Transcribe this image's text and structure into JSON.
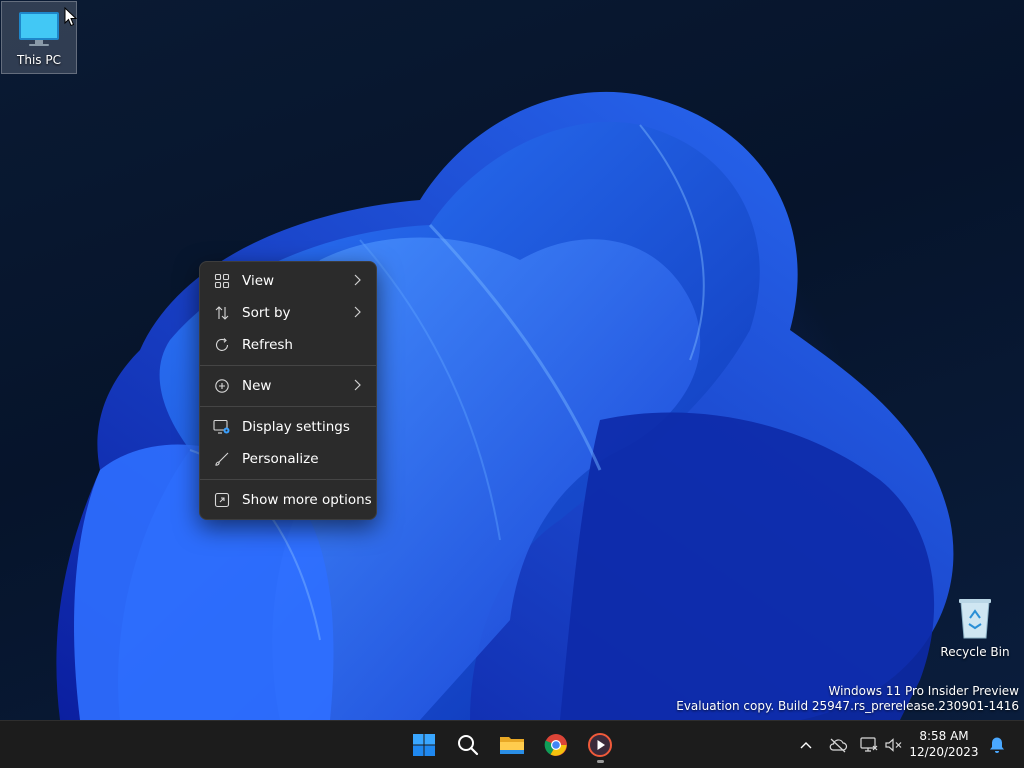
{
  "desktop": {
    "icons": [
      {
        "label": "This PC",
        "icon": "monitor-icon"
      },
      {
        "label": "Recycle Bin",
        "icon": "recycle-bin-icon"
      }
    ],
    "watermark": {
      "line1": "Windows 11 Pro Insider Preview",
      "line2": "Evaluation copy. Build 25947.rs_prerelease.230901-1416"
    }
  },
  "context_menu": {
    "items": [
      {
        "label": "View",
        "icon": "grid-view-icon",
        "submenu": true
      },
      {
        "label": "Sort by",
        "icon": "sort-arrows-icon",
        "submenu": true
      },
      {
        "label": "Refresh",
        "icon": "refresh-icon",
        "submenu": false
      },
      {
        "label": "New",
        "icon": "plus-circle-icon",
        "submenu": true
      },
      {
        "label": "Display settings",
        "icon": "display-settings-icon",
        "submenu": false
      },
      {
        "label": "Personalize",
        "icon": "brush-icon",
        "submenu": false
      },
      {
        "label": "Show more options",
        "icon": "expand-window-icon",
        "submenu": false
      }
    ]
  },
  "taskbar": {
    "apps": [
      {
        "name": "Start",
        "icon": "windows-logo-icon"
      },
      {
        "name": "Search",
        "icon": "search-icon"
      },
      {
        "name": "File Explorer",
        "icon": "folder-icon"
      },
      {
        "name": "Google Chrome",
        "icon": "chrome-icon"
      },
      {
        "name": "Media Player",
        "icon": "media-player-icon"
      }
    ],
    "tray": {
      "icons": [
        "chevron-up-icon",
        "onedrive-offline-icon",
        "network-icon",
        "volume-muted-icon"
      ],
      "time": "8:58 AM",
      "date": "12/20/2023",
      "notification_icon": "bell-icon"
    }
  },
  "colors": {
    "accent": "#0078d4",
    "menu_bg": "#2b2b2b",
    "taskbar_bg": "#1c1c1c"
  }
}
